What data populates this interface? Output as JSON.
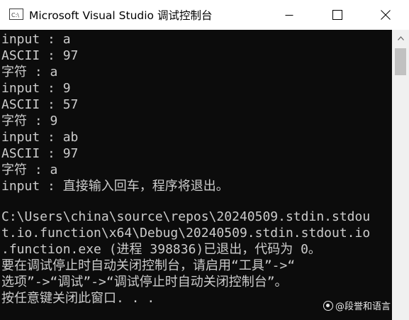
{
  "window": {
    "title": "Microsoft Visual Studio 调试控制台",
    "icon": "visual-studio-console-icon",
    "controls": [
      "minimize-icon",
      "maximize-icon",
      "close-icon"
    ]
  },
  "console": {
    "lines": [
      "input : a",
      "ASCII : 97",
      "字符 : a",
      "input : 9",
      "ASCII : 57",
      "字符 : 9",
      "input : ab",
      "ASCII : 97",
      "字符 : a",
      "input : 直接输入回车，程序将退出。",
      "",
      "C:\\Users\\china\\source\\repos\\20240509.stdin.stdou",
      "t.io.function\\x64\\Debug\\20240509.stdin.stdout.io",
      ".function.exe (进程 398836)已退出，代码为 0。",
      "要在调试停止时自动关闭控制台，请启用“工具”->“",
      "选项”->“调试”->“调试停止时自动关闭控制台”。",
      "按任意键关闭此窗口. . ."
    ]
  },
  "watermark": {
    "text": "@段誉和语言"
  },
  "colors": {
    "console_bg": "#0c0c0c",
    "console_text": "#cccccc",
    "titlebar_bg": "#ffffff"
  }
}
